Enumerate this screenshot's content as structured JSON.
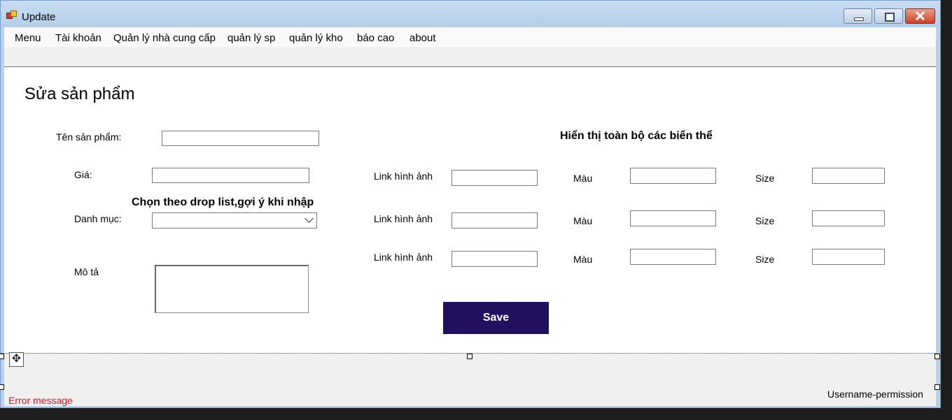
{
  "window": {
    "title": "Update"
  },
  "menu": [
    "Menu",
    "Tài khoản",
    "Quản lý nhà cung cấp",
    "quản lý sp",
    "quản lý kho",
    "báo cao",
    "about"
  ],
  "form": {
    "heading": "Sửa sản phẩm",
    "name_label": "Tên sản phẩm:",
    "price_label": "Giá:",
    "category_label": "Danh mục:",
    "category_hint": "Chọn theo drop list,gợi ý khi nhập",
    "description_label": "Mô tả",
    "variants_heading": "Hiển thị toàn bộ các biến thể",
    "variant_rows": [
      {
        "image_label": "Link hình ảnh",
        "color_label": "Màu",
        "size_label": "Size"
      },
      {
        "image_label": "Link hình ảnh",
        "color_label": "Màu",
        "size_label": "Size"
      },
      {
        "image_label": "Link hình ảnh",
        "color_label": "Màu",
        "size_label": "Size"
      }
    ],
    "save_label": "Save"
  },
  "status": {
    "error_message": "Error message",
    "user_permission": "Username-permission"
  },
  "colors": {
    "save_button": "#231160",
    "error_text": "#e81123"
  }
}
